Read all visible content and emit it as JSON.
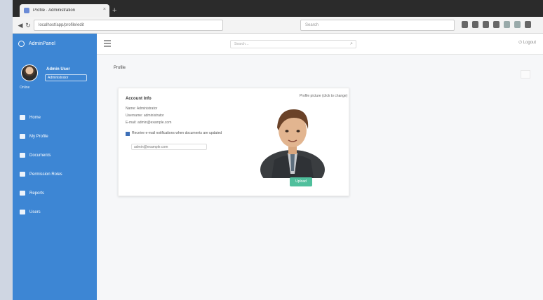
{
  "browser": {
    "tab_title": "Profile · Administration",
    "new_tab": "+",
    "close_tab": "×",
    "address": "localhost/app/profile/edit",
    "search_placeholder": "Search"
  },
  "sidebar": {
    "brand": "AdminPanel",
    "user_name": "Admin User",
    "user_role": "Administrator",
    "user_status": "Online",
    "items": [
      {
        "label": "Home"
      },
      {
        "label": "My Profile"
      },
      {
        "label": "Documents"
      },
      {
        "label": "Permission Roles"
      },
      {
        "label": "Reports"
      },
      {
        "label": "Users"
      }
    ]
  },
  "topbar": {
    "search_placeholder": "Search…",
    "logout": "⏻ Logout"
  },
  "main": {
    "breadcrumb": "Profile",
    "card": {
      "title": "Account Info",
      "lines": [
        "Name: Administrator",
        "Username: administrator",
        "E-mail: admin@example.com"
      ],
      "checkbox_label": "Receive e-mail notifications when documents are updated",
      "input_value": "admin@example.com",
      "photo_label": "Profile picture (click to change)",
      "upload_label": "Upload"
    }
  },
  "colors": {
    "sidebar": "#3d86d4",
    "upload": "#4fbf9c",
    "chrome": "#2b2b2b"
  }
}
